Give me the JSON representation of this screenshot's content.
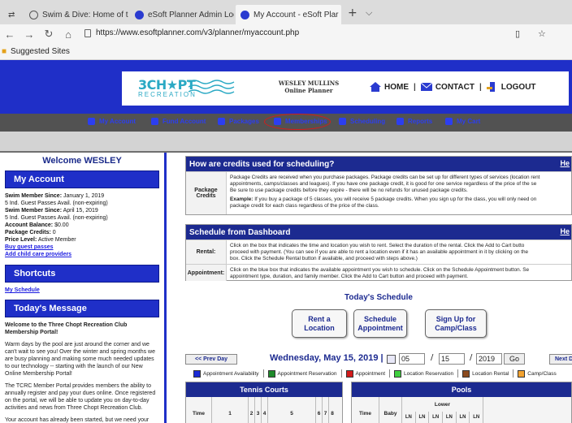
{
  "browser": {
    "tabs": [
      {
        "title": "Swim & Dive: Home of the"
      },
      {
        "title": "eSoft Planner Admin Login"
      },
      {
        "title": "My Account - eSoft Plar"
      }
    ],
    "url": "https://www.esoftplanner.com/v3/planner/myaccount.php",
    "favorites_label": "Suggested Sites"
  },
  "header": {
    "logo_main": "3CH★PT",
    "logo_sub": "RECREATION",
    "user_name": "WESLEY MULLINS",
    "user_role": "Online Planner",
    "links": [
      "HOME",
      "CONTACT",
      "LOGOUT"
    ]
  },
  "nav": {
    "items": [
      "My Account",
      "Fund Account",
      "Packages",
      "Memberships",
      "Scheduling",
      "Reports",
      "My Cart"
    ]
  },
  "sidebar": {
    "welcome": "Welcome WESLEY",
    "my_account_title": "My Account",
    "account_lines": [
      {
        "label": "Swim Member Since:",
        "value": "January 1, 2019"
      },
      {
        "label": "",
        "value": "5 Ind. Guest Passes Avail. (non-expiring)"
      },
      {
        "label": "Swim Member Since:",
        "value": "April 15, 2019"
      },
      {
        "label": "",
        "value": "5 Ind. Guest Passes Avail. (non-expiring)"
      },
      {
        "label": "Account Balance:",
        "value": "$0.00"
      },
      {
        "label": "Package Credits:",
        "value": "0"
      },
      {
        "label": "Price Level:",
        "value": "Active Member"
      }
    ],
    "buy_guest_passes": "Buy guest passes",
    "add_child_care": "Add child care providers",
    "shortcuts_title": "Shortcuts",
    "my_schedule": "My Schedule",
    "todays_message_title": "Today's Message",
    "message_heading": "Welcome to the Three Chopt Recreation Club Membership Portal!",
    "message_p1": "Warm days by the pool are just around the corner and we can't wait to see you! Over the winter and spring months we are busy planning and making some much needed updates to our technology -- starting with the launch of our New Online Membership Portal!",
    "message_p2": "The TCRC Member Portal provides members the ability to annually register and pay your dues online. Once registered on the portal, we will be able to update you on day-to-day activities and news from Three Chopt Recreation Club.",
    "message_p3": "Your account has already been started, but we need your help updating the information (ie."
  },
  "credits_panel": {
    "title": "How are credits used for scheduling?",
    "help": "He",
    "label": "Package Credits",
    "text1": "Package Credits are received when you purchase packages. Package credits can be set up for different types of services (location rent",
    "text2": "appointments, camps/classes and leagues). If you have one package credit, it is good for one service regardless of the price of the se",
    "text3": "Be sure to use package credits before they expire - there will be no refunds for unused package credits.",
    "example_label": "Example:",
    "example1": "If you buy a package of 5 classes, you will receive 5 package credits. When you sign up for the class, you will only need on",
    "example2": "package credit for each class regardless of the price of the class."
  },
  "schedule_panel": {
    "title": "Schedule from Dashboard",
    "help": "He",
    "rental_label": "Rental:",
    "rental1": "Click on the box that indicates the time and location you wish to rent. Select the duration of the rental. Click the Add to Cart butto",
    "rental2": "proceed with payment. (You can see if you are able to rent a location even if it has an available appointment in it by clicking on the",
    "rental3": "box. Click the Schedule Rental button if available, and proceed with steps above.)",
    "appt_label": "Appointment:",
    "appt1": "Click on the blue box that indicates the available appointment you wish to schedule. Click on the Schedule Appointment button. Se",
    "appt2": "appointment type, duration, and family member. Click the Add to Cart button and proceed with payment."
  },
  "today": {
    "title": "Today's Schedule",
    "buttons": [
      "Rent a Location",
      "Schedule Appointment",
      "Sign Up for Camp/Class"
    ]
  },
  "datebar": {
    "prev": "<< Prev Day",
    "date_text": "Wednesday, May 15, 2019 |",
    "month": "05",
    "day": "15",
    "year": "2019",
    "go": "Go",
    "next": "Next Da"
  },
  "legend": [
    {
      "label": "Appointment Availability",
      "color": "#1a2ad6"
    },
    {
      "label": "Appointment Reservation",
      "color": "#1e8a2a"
    },
    {
      "label": "Appointment",
      "color": "#d21a1a"
    },
    {
      "label": "Location Reservation",
      "color": "#3fcf3f"
    },
    {
      "label": "Location Rental",
      "color": "#8b4a1e"
    },
    {
      "label": "Camp/Class",
      "color": "#f2a230"
    }
  ],
  "tennis": {
    "title": "Tennis Courts",
    "cols": [
      "Time",
      "1",
      "2",
      "3",
      "4",
      "5",
      "6",
      "7",
      "8"
    ]
  },
  "pools": {
    "title": "Pools",
    "cols": [
      "Time",
      "Baby",
      "Lower"
    ],
    "lanes": [
      "LN",
      "LN",
      "LN",
      "LN",
      "LN",
      "LN"
    ]
  }
}
